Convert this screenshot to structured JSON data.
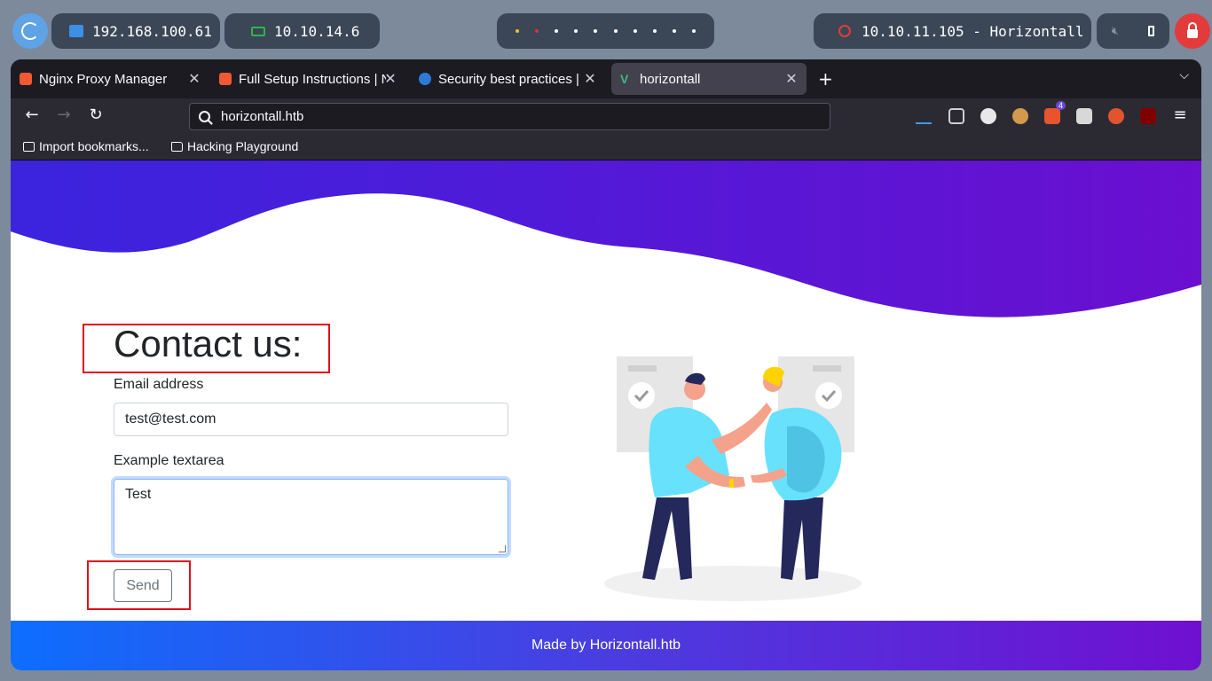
{
  "panel": {
    "ip_local": "192.168.100.61",
    "ip_vpn": "10.10.14.6",
    "target": "10.10.11.105 - Horizontall",
    "colors": {
      "pill": "#3b4656",
      "lock": "#e33b3b",
      "accent": "#5ea3e6"
    }
  },
  "browser": {
    "tabs": [
      {
        "title": "Nginx Proxy Manager",
        "active": false
      },
      {
        "title": "Full Setup Instructions | N",
        "active": false
      },
      {
        "title": "Security best practices | N",
        "active": false
      },
      {
        "title": "horizontall",
        "active": true
      }
    ],
    "url": "horizontall.htb",
    "extension_badge": "4",
    "bookmarks": [
      {
        "label": "Import bookmarks...",
        "icon": "import-icon"
      },
      {
        "label": "Hacking Playground",
        "icon": "folder-icon"
      }
    ]
  },
  "page": {
    "heading": "Contact us:",
    "email_label": "Email address",
    "email_value": "test@test.com",
    "textarea_label": "Example textarea",
    "textarea_value": "Test",
    "send_label": "Send",
    "footer_text": "Made by Horizontall.htb",
    "colors": {
      "gradient_start": "#0d6efd",
      "gradient_end": "#6f10d0",
      "highlight": "#e0101a"
    }
  }
}
